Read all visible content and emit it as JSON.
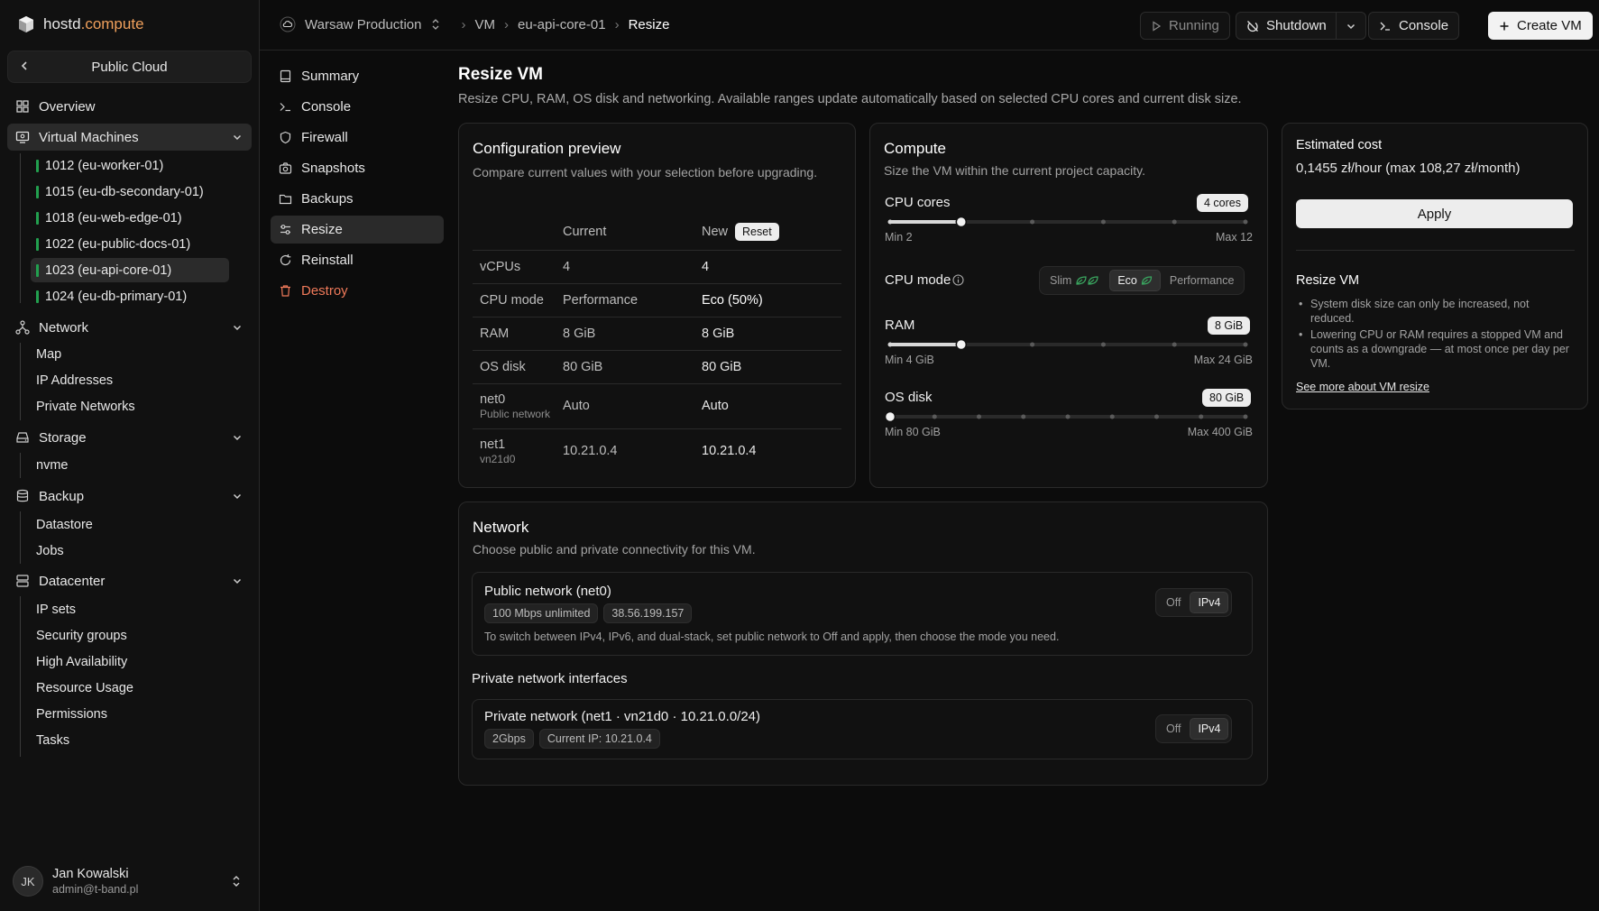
{
  "app": {
    "brand": "hostd",
    "brand_accent": ".compute"
  },
  "sidebar": {
    "context": "Public Cloud",
    "overview": "Overview",
    "virtual_machines": "Virtual Machines",
    "vms": [
      {
        "label": "1012 (eu-worker-01)"
      },
      {
        "label": "1015 (eu-db-secondary-01)"
      },
      {
        "label": "1018 (eu-web-edge-01)"
      },
      {
        "label": "1022 (eu-public-docs-01)"
      },
      {
        "label": "1023 (eu-api-core-01)"
      },
      {
        "label": "1024 (eu-db-primary-01)"
      }
    ],
    "network": "Network",
    "network_items": [
      "Map",
      "IP Addresses",
      "Private Networks"
    ],
    "storage": "Storage",
    "storage_items": [
      "nvme"
    ],
    "backup": "Backup",
    "backup_items": [
      "Datastore",
      "Jobs"
    ],
    "datacenter": "Datacenter",
    "datacenter_items": [
      "IP sets",
      "Security groups",
      "High Availability",
      "Resource Usage",
      "Permissions",
      "Tasks"
    ],
    "user": {
      "initials": "JK",
      "name": "Jan Kowalski",
      "email": "admin@t-band.pl"
    }
  },
  "topbar": {
    "project": "Warsaw Production",
    "crumb_vm": "VM",
    "crumb_host": "eu-api-core-01",
    "crumb_current": "Resize",
    "status": "Running",
    "shutdown": "Shutdown",
    "console": "Console",
    "create": "Create VM"
  },
  "subnav": [
    "Summary",
    "Console",
    "Firewall",
    "Snapshots",
    "Backups",
    "Resize",
    "Reinstall",
    "Destroy"
  ],
  "page": {
    "title": "Resize VM",
    "description": "Resize CPU, RAM, OS disk and networking. Available ranges update automatically based on selected CPU cores and current disk size."
  },
  "preview": {
    "title": "Configuration preview",
    "subtitle": "Compare current values with your selection before upgrading.",
    "col_current": "Current",
    "col_new": "New",
    "reset": "Reset",
    "rows": [
      {
        "label": "vCPUs",
        "sub": "",
        "current": "4",
        "new": "4"
      },
      {
        "label": "CPU mode",
        "sub": "",
        "current": "Performance",
        "new": "Eco (50%)"
      },
      {
        "label": "RAM",
        "sub": "",
        "current": "8 GiB",
        "new": "8 GiB"
      },
      {
        "label": "OS disk",
        "sub": "",
        "current": "80 GiB",
        "new": "80 GiB"
      },
      {
        "label": "net0",
        "sub": "Public network",
        "current": "Auto",
        "new": "Auto"
      },
      {
        "label": "net1",
        "sub": "vn21d0",
        "current": "10.21.0.4",
        "new": "10.21.0.4"
      }
    ]
  },
  "compute": {
    "title": "Compute",
    "subtitle": "Size the VM within the current project capacity.",
    "cpu": {
      "label": "CPU cores",
      "value": "4 cores",
      "min": "Min 2",
      "max": "Max 12",
      "level": 0.2
    },
    "cpu_mode": {
      "label": "CPU mode",
      "options": [
        "Slim",
        "Eco",
        "Performance"
      ],
      "selected": "Eco"
    },
    "ram": {
      "label": "RAM",
      "value": "8 GiB",
      "min": "Min 4 GiB",
      "max": "Max 24 GiB",
      "level": 0.2
    },
    "disk": {
      "label": "OS disk",
      "value": "80 GiB",
      "min": "Min 80 GiB",
      "max": "Max 400 GiB",
      "level": 0.0
    }
  },
  "cost": {
    "label": "Estimated cost",
    "value": "0,1455 zł/hour (max 108,27 zł/month)",
    "apply": "Apply",
    "info_title": "Resize VM",
    "info": [
      "System disk size can only be increased, not reduced.",
      "Lowering CPU or RAM requires a stopped VM and counts as a downgrade — at most once per day per VM."
    ],
    "link": "See more about VM resize"
  },
  "network": {
    "title": "Network",
    "subtitle": "Choose public and private connectivity for this VM.",
    "public": {
      "title": "Public network (net0)",
      "tags": [
        "100 Mbps unlimited",
        "38.56.199.157"
      ],
      "note": "To switch between IPv4, IPv6, and dual-stack, set public network to Off and apply, then choose the mode you need.",
      "options": [
        "Off",
        "IPv4"
      ]
    },
    "private_heading": "Private network interfaces",
    "private": {
      "title": "Private network (net1 · vn21d0 · 10.21.0.0/24)",
      "tags": [
        "2Gbps",
        "Current IP: 10.21.0.4"
      ],
      "options": [
        "Off",
        "IPv4"
      ]
    }
  }
}
